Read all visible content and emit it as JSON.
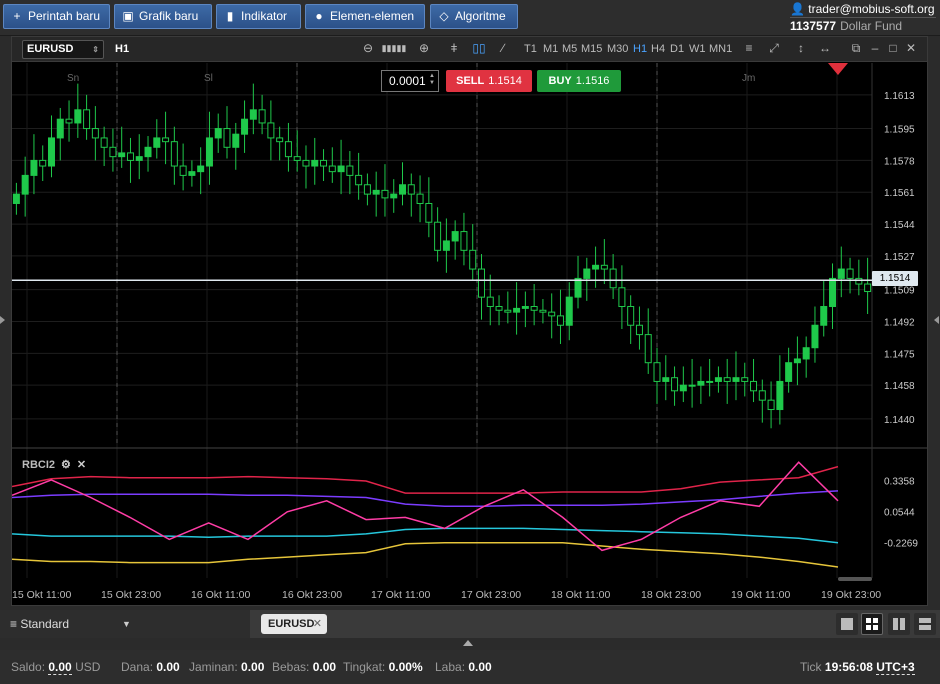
{
  "toolbar": {
    "buttons": [
      {
        "label": "Perintah baru",
        "icon": "plus-icon"
      },
      {
        "label": "Grafik baru",
        "icon": "chart-icon"
      },
      {
        "label": "Indikator",
        "icon": "bars-icon"
      },
      {
        "label": "Elemen-elemen",
        "icon": "shapes-icon"
      },
      {
        "label": "Algoritme",
        "icon": "diamond-icon"
      }
    ]
  },
  "account": {
    "user": "trader@mobius-soft.org",
    "balance": "1137577",
    "fund": "Dollar Fund"
  },
  "chart_header": {
    "symbol": "EURUSD",
    "timeframe": "H1",
    "timeframes": [
      "T1",
      "M1",
      "M5",
      "M15",
      "M30",
      "H1",
      "H4",
      "D1",
      "W1",
      "MN1"
    ],
    "active_timeframe": "H1"
  },
  "trade_panel": {
    "lot": "0.0001",
    "sell_label": "SELL",
    "sell_price": "1.1514",
    "buy_label": "BUY",
    "buy_price": "1.1516"
  },
  "indicator": {
    "name": "RBCI2"
  },
  "day_labels": [
    "Sn",
    "Sl",
    "Jm"
  ],
  "colors": {
    "bull": "#1fc94b",
    "bear": "#1fc94b",
    "sell": "#e03341",
    "buy": "#1f9a3a",
    "current_price": "#dfe8ef"
  },
  "chart_data": {
    "type": "candlestick",
    "price_ticks": [
      "1.1613",
      "1.1595",
      "1.1578",
      "1.1561",
      "1.1544",
      "1.1527",
      "1.1509",
      "1.1492",
      "1.1475",
      "1.1458",
      "1.1440"
    ],
    "current_price": "1.1514",
    "x_ticks": [
      "15 Okt 11:00",
      "15 Okt 23:00",
      "16 Okt 11:00",
      "16 Okt 23:00",
      "17 Okt 11:00",
      "17 Okt 23:00",
      "18 Okt 11:00",
      "18 Okt 23:00",
      "19 Okt 11:00",
      "19 Okt 23:00"
    ],
    "close_series": [
      1.156,
      1.157,
      1.1578,
      1.1575,
      1.159,
      1.16,
      1.1598,
      1.1605,
      1.1595,
      1.159,
      1.1585,
      1.158,
      1.1582,
      1.1578,
      1.158,
      1.1585,
      1.159,
      1.1588,
      1.1575,
      1.157,
      1.1572,
      1.1575,
      1.159,
      1.1595,
      1.1585,
      1.1592,
      1.16,
      1.1605,
      1.1598,
      1.159,
      1.1588,
      1.158,
      1.1578,
      1.1575,
      1.1578,
      1.1575,
      1.1572,
      1.1575,
      1.157,
      1.1565,
      1.156,
      1.1562,
      1.1558,
      1.156,
      1.1565,
      1.156,
      1.1555,
      1.1545,
      1.153,
      1.1535,
      1.154,
      1.153,
      1.152,
      1.1505,
      1.15,
      1.1498,
      1.1497,
      1.1499,
      1.15,
      1.1498,
      1.1497,
      1.1495,
      1.149,
      1.1505,
      1.1515,
      1.152,
      1.1522,
      1.152,
      1.151,
      1.15,
      1.149,
      1.1485,
      1.147,
      1.146,
      1.1462,
      1.1455,
      1.1458,
      1.1458,
      1.146,
      1.146,
      1.1462,
      1.146,
      1.1462,
      1.146,
      1.1455,
      1.145,
      1.1445,
      1.146,
      1.147,
      1.1472,
      1.1478,
      1.149,
      1.15,
      1.1515,
      1.152,
      1.1515,
      1.1512,
      1.1508
    ],
    "indicator_ticks": [
      "0.3358",
      "0.0544",
      "-0.2269"
    ],
    "indicator_series": [
      {
        "color": "#e0244a",
        "values": [
          0.28,
          0.35,
          0.37,
          0.36,
          0.36,
          0.36,
          0.37,
          0.36,
          0.35,
          0.33,
          0.22,
          0.22,
          0.22,
          0.22,
          0.23,
          0.23,
          0.23,
          0.26,
          0.32,
          0.34,
          0.36,
          0.46
        ]
      },
      {
        "color": "#7b3cff",
        "values": [
          0.18,
          0.2,
          0.21,
          0.21,
          0.21,
          0.21,
          0.2,
          0.2,
          0.19,
          0.18,
          0.12,
          0.1,
          0.1,
          0.11,
          0.11,
          0.11,
          0.12,
          0.14,
          0.16,
          0.19,
          0.22,
          0.24
        ]
      },
      {
        "color": "#25c7dc",
        "values": [
          -0.15,
          -0.17,
          -0.17,
          -0.17,
          -0.17,
          -0.18,
          -0.17,
          -0.17,
          -0.17,
          -0.15,
          -0.11,
          -0.1,
          -0.1,
          -0.1,
          -0.11,
          -0.12,
          -0.13,
          -0.14,
          -0.15,
          -0.17,
          -0.19,
          -0.23
        ]
      },
      {
        "color": "#e6c53a",
        "values": [
          -0.38,
          -0.4,
          -0.4,
          -0.41,
          -0.41,
          -0.41,
          -0.38,
          -0.36,
          -0.34,
          -0.32,
          -0.24,
          -0.23,
          -0.23,
          -0.23,
          -0.23,
          -0.26,
          -0.29,
          -0.31,
          -0.33,
          -0.36,
          -0.4,
          -0.45
        ]
      },
      {
        "color": "#ff3da6",
        "values": [
          0.2,
          0.34,
          0.18,
          0.0,
          -0.2,
          -0.05,
          -0.2,
          0.05,
          0.15,
          -0.02,
          0.0,
          -0.1,
          0.1,
          0.25,
          0.0,
          -0.3,
          -0.2,
          0.0,
          0.15,
          0.1,
          0.5,
          0.15
        ]
      }
    ]
  },
  "bottom": {
    "layout": "Standard",
    "symbol_tab": "EURUSD"
  },
  "status": {
    "saldo_label": "Saldo:",
    "saldo": "0.00",
    "saldo_cur": "USD",
    "dana_label": "Dana:",
    "dana": "0.00",
    "jaminan_label": "Jaminan:",
    "jaminan": "0.00",
    "bebas_label": "Bebas:",
    "bebas": "0.00",
    "tingkat_label": "Tingkat:",
    "tingkat": "0.00%",
    "laba_label": "Laba:",
    "laba": "0.00",
    "tick_label": "Tick",
    "time": "19:56:08",
    "tz": "UTC+3"
  }
}
